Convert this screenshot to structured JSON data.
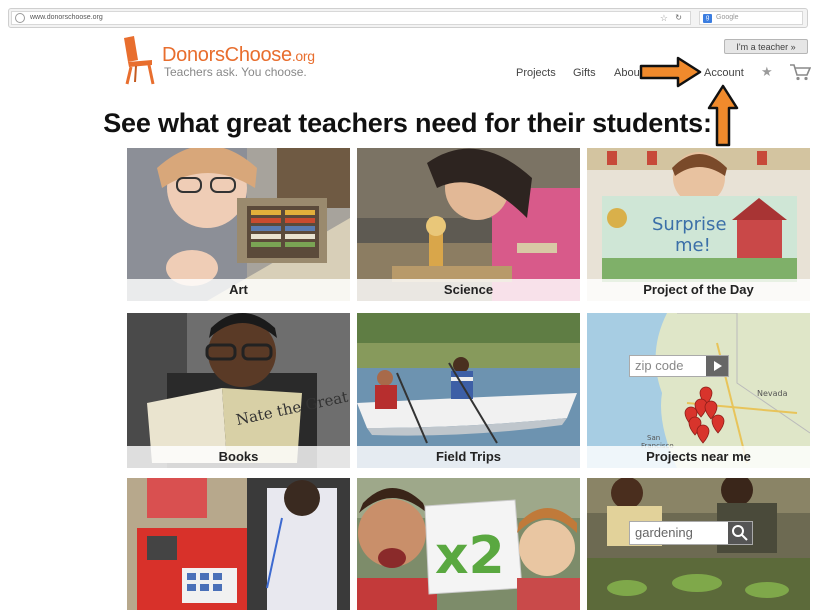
{
  "browser": {
    "url": "www.donorschoose.org",
    "search_placeholder": "Google"
  },
  "header": {
    "logo_name": "DonorsChoose",
    "logo_tld": ".org",
    "tagline": "Teachers ask. You choose.",
    "teacher_button": "I'm a teacher »",
    "nav": [
      "Projects",
      "Gifts",
      "About",
      "Account"
    ]
  },
  "headline": "See what great teachers need for their students:",
  "tiles": [
    {
      "caption": "Art"
    },
    {
      "caption": "Science"
    },
    {
      "caption": "Project of the Day"
    },
    {
      "caption": "Books"
    },
    {
      "caption": "Field Trips"
    },
    {
      "caption": "Projects near me"
    }
  ],
  "photo_text": {
    "sign": "Surprise me!",
    "book": "Nate the Great",
    "card": "x2",
    "map_labels": [
      "Nevada",
      "San Francisco"
    ]
  },
  "zip_placeholder": "zip code",
  "search_value": "gardening",
  "colors": {
    "brand": "#e86e2e",
    "arrow": "#f08a2c"
  }
}
